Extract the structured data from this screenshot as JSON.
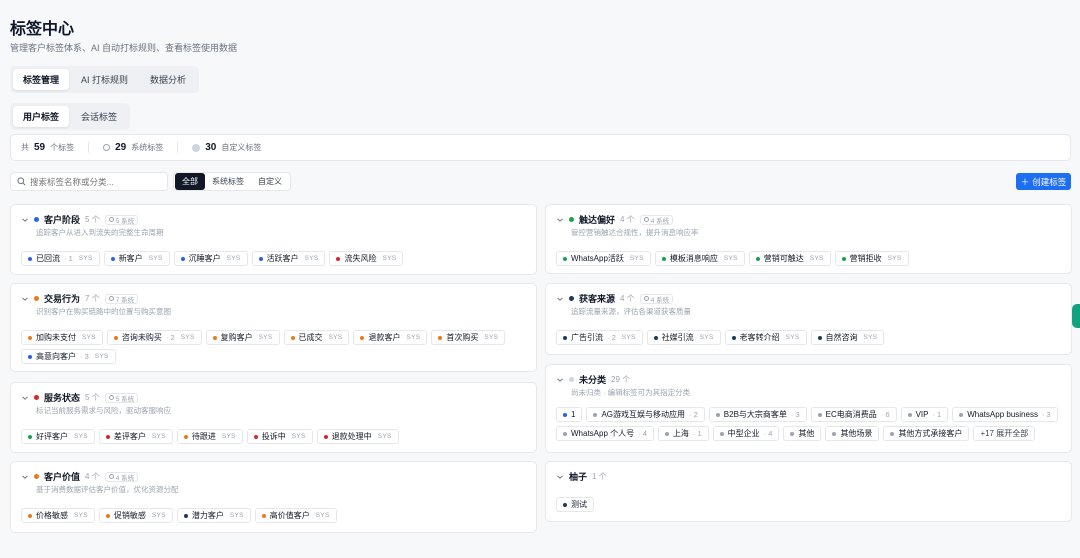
{
  "page": {
    "title": "标签中心",
    "subtitle": "管理客户标签体系、AI 自动打标规则、查看标签使用数据"
  },
  "main_tabs": [
    {
      "label": "标签管理",
      "active": true
    },
    {
      "label": "AI 打标规则",
      "active": false
    },
    {
      "label": "数据分析",
      "active": false
    }
  ],
  "sub_tabs": [
    {
      "label": "用户标签",
      "active": true
    },
    {
      "label": "会话标签",
      "active": false
    }
  ],
  "stats": {
    "total_prefix": "共",
    "total": "59",
    "total_suffix": "个标签",
    "system_count": "29",
    "system_label": "系统标签",
    "custom_count": "30",
    "custom_label": "自定义标签"
  },
  "search": {
    "placeholder": "搜索标签名称或分类..."
  },
  "filters": [
    {
      "label": "全部",
      "active": true
    },
    {
      "label": "系统标签",
      "active": false
    },
    {
      "label": "自定义",
      "active": false
    }
  ],
  "create_button": "创建标签",
  "colors": {
    "accent": "#1d6ef2",
    "blue": "#2563eb",
    "orange": "#ea7a1a",
    "red": "#dc2626",
    "green": "#16a34a",
    "navy": "#1e3a5f",
    "gray": "#9ca3af"
  },
  "cards": [
    {
      "title": "客户阶段",
      "count": "5 个",
      "sys": "5 系统",
      "desc": "追踪客户从进入到流失的完整生命周期",
      "dot": "#2563eb",
      "tags": [
        {
          "name": "已回流",
          "count": "· 1",
          "sys": "SYS",
          "dot": "#2563eb"
        },
        {
          "name": "新客户",
          "count": "",
          "sys": "SYS",
          "dot": "#2563eb"
        },
        {
          "name": "沉睡客户",
          "count": "",
          "sys": "SYS",
          "dot": "#2563eb"
        },
        {
          "name": "活跃客户",
          "count": "",
          "sys": "SYS",
          "dot": "#2563eb"
        },
        {
          "name": "流失风险",
          "count": "",
          "sys": "SYS",
          "dot": "#dc2626"
        }
      ]
    },
    {
      "title": "交易行为",
      "count": "7 个",
      "sys": "7 系统",
      "desc": "识别客户在购买链路中的位置与购买意图",
      "dot": "#ea7a1a",
      "tags": [
        {
          "name": "加购未支付",
          "count": "",
          "sys": "SYS",
          "dot": "#ea7a1a"
        },
        {
          "name": "咨询未购买",
          "count": "· 2",
          "sys": "SYS",
          "dot": "#ea7a1a"
        },
        {
          "name": "复购客户",
          "count": "",
          "sys": "SYS",
          "dot": "#ea7a1a"
        },
        {
          "name": "已成交",
          "count": "",
          "sys": "SYS",
          "dot": "#ea7a1a"
        },
        {
          "name": "退款客户",
          "count": "",
          "sys": "SYS",
          "dot": "#ea7a1a"
        },
        {
          "name": "首次购买",
          "count": "",
          "sys": "SYS",
          "dot": "#ea7a1a"
        },
        {
          "name": "高意向客户",
          "count": "· 3",
          "sys": "SYS",
          "dot": "#2563eb"
        }
      ]
    },
    {
      "title": "服务状态",
      "count": "5 个",
      "sys": "5 系统",
      "desc": "标记当前服务需求与风险，驱动客服响应",
      "dot": "#dc2626",
      "tags": [
        {
          "name": "好评客户",
          "count": "",
          "sys": "SYS",
          "dot": "#16a34a"
        },
        {
          "name": "差评客户",
          "count": "",
          "sys": "SYS",
          "dot": "#dc2626"
        },
        {
          "name": "待跟进",
          "count": "",
          "sys": "SYS",
          "dot": "#ea7a1a"
        },
        {
          "name": "投诉中",
          "count": "",
          "sys": "SYS",
          "dot": "#dc2626"
        },
        {
          "name": "退款处理中",
          "count": "",
          "sys": "SYS",
          "dot": "#dc2626"
        }
      ]
    },
    {
      "title": "客户价值",
      "count": "4 个",
      "sys": "4 系统",
      "desc": "基于消费数据评估客户价值，优化资源分配",
      "dot": "#ea7a1a",
      "tags": [
        {
          "name": "价格敏感",
          "count": "",
          "sys": "SYS",
          "dot": "#ea7a1a"
        },
        {
          "name": "促销敏感",
          "count": "",
          "sys": "SYS",
          "dot": "#ea7a1a"
        },
        {
          "name": "潜力客户",
          "count": "",
          "sys": "SYS",
          "dot": "#1e3a5f"
        },
        {
          "name": "高价值客户",
          "count": "",
          "sys": "SYS",
          "dot": "#ea7a1a"
        }
      ]
    },
    {
      "title": "触达偏好",
      "count": "4 个",
      "sys": "4 系统",
      "desc": "管控营销触达合规性，提升消息响应率",
      "dot": "#16a34a",
      "tags": [
        {
          "name": "WhatsApp活跃",
          "count": "",
          "sys": "SYS",
          "dot": "#16a34a"
        },
        {
          "name": "模板消息响应",
          "count": "",
          "sys": "SYS",
          "dot": "#16a34a"
        },
        {
          "name": "营销可触达",
          "count": "",
          "sys": "SYS",
          "dot": "#16a34a"
        },
        {
          "name": "营销拒收",
          "count": "",
          "sys": "SYS",
          "dot": "#16a34a"
        }
      ]
    },
    {
      "title": "获客来源",
      "count": "4 个",
      "sys": "4 系统",
      "desc": "追踪流量来源，评估各渠道获客质量",
      "dot": "#1e3a5f",
      "tags": [
        {
          "name": "广告引流",
          "count": "· 2",
          "sys": "SYS",
          "dot": "#1e3a5f"
        },
        {
          "name": "社媒引流",
          "count": "",
          "sys": "SYS",
          "dot": "#1e3a5f"
        },
        {
          "name": "老客转介绍",
          "count": "",
          "sys": "SYS",
          "dot": "#1e3a5f"
        },
        {
          "name": "自然咨询",
          "count": "",
          "sys": "SYS",
          "dot": "#1e3a5f"
        }
      ]
    },
    {
      "title": "未分类",
      "count": "29 个",
      "sys": "",
      "desc": "尚未归类 · 编辑标签可为其指定分类",
      "dot": "#cbd5e1",
      "tags": [
        {
          "name": "1",
          "count": "",
          "sys": "",
          "dot": "#2563eb"
        },
        {
          "name": "AG游戏互娱与移动应用",
          "count": "· 2",
          "sys": "",
          "dot": "#9ca3af"
        },
        {
          "name": "B2B与大宗商客单",
          "count": "· 3",
          "sys": "",
          "dot": "#9ca3af"
        },
        {
          "name": "EC电商消费品",
          "count": "· 6",
          "sys": "",
          "dot": "#9ca3af"
        },
        {
          "name": "VIP",
          "count": "· 1",
          "sys": "",
          "dot": "#9ca3af"
        },
        {
          "name": "WhatsApp business",
          "count": "· 3",
          "sys": "",
          "dot": "#9ca3af"
        },
        {
          "name": "WhatsApp 个人号",
          "count": "· 4",
          "sys": "",
          "dot": "#9ca3af"
        },
        {
          "name": "上海",
          "count": "· 1",
          "sys": "",
          "dot": "#9ca3af"
        },
        {
          "name": "中型企业",
          "count": "· 4",
          "sys": "",
          "dot": "#9ca3af"
        },
        {
          "name": "其他",
          "count": "",
          "sys": "",
          "dot": "#9ca3af"
        },
        {
          "name": "其他场景",
          "count": "",
          "sys": "",
          "dot": "#9ca3af"
        },
        {
          "name": "其他方式承接客户",
          "count": "",
          "sys": "",
          "dot": "#9ca3af"
        }
      ],
      "more": "+17 展开全部"
    },
    {
      "title": "柚子",
      "count": "1 个",
      "sys": "",
      "desc": "",
      "dot": "",
      "tags": [
        {
          "name": "测试",
          "count": "",
          "sys": "",
          "dot": "#1e3a5f"
        }
      ]
    }
  ]
}
